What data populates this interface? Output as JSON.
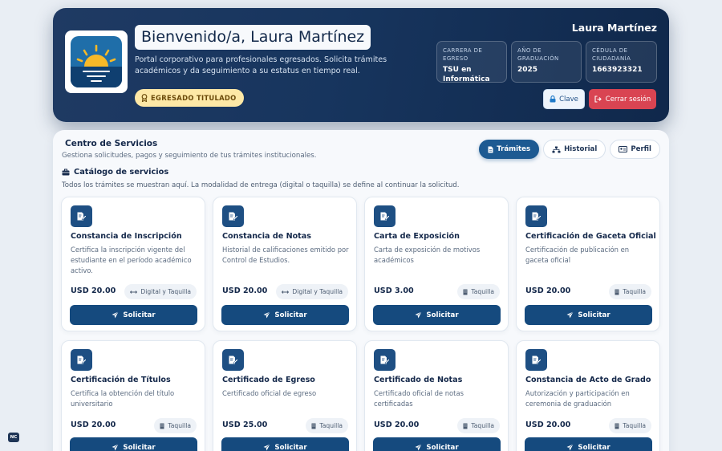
{
  "header": {
    "welcome": "Bienvenido/a, Laura Martínez",
    "description": "Portal corporativo para profesionales egresados. Solicita trámites académicos y da seguimiento a su estatus en tiempo real.",
    "badge": "EGRESADO TITULADO",
    "user_name": "Laura Martínez",
    "info": [
      {
        "label": "CARRERA DE EGRESO",
        "value": "TSU en Informática"
      },
      {
        "label": "AÑO DE GRADUACIÓN",
        "value": "2025"
      },
      {
        "label": "CÉDULA DE CIUDADANÍA",
        "value": "1663923321"
      }
    ],
    "btn_password": "Clave",
    "btn_logout": "Cerrar sesión"
  },
  "main": {
    "title": "Centro de Servicios",
    "subtitle": "Gestiona solicitudes, pagos y seguimiento de tus trámites institucionales.",
    "tabs": [
      {
        "label": "Trámites",
        "icon": "file-icon"
      },
      {
        "label": "Historial",
        "icon": "sitemap-icon"
      },
      {
        "label": "Perfil",
        "icon": "id-card-icon"
      }
    ],
    "catalog_title": "Catálogo de servicios",
    "catalog_sub": "Todos los trámites se muestran aquí. La modalidad de entrega (digital o taquilla) se define al continuar la solicitud.",
    "cards": [
      {
        "title": "Constancia de Inscripción",
        "desc": "Certifica la inscripción vigente del estudiante en el período académico activo.",
        "price": "USD 20.00",
        "mode": "Digital y Taquilla",
        "mode_icon": "swap-icon",
        "action": "Solicitar"
      },
      {
        "title": "Constancia de Notas",
        "desc": "Historial de calificaciones emitido por Control de Estudios.",
        "price": "USD 20.00",
        "mode": "Digital y Taquilla",
        "mode_icon": "swap-icon",
        "action": "Solicitar"
      },
      {
        "title": "Carta de Exposición",
        "desc": "Carta de exposición de motivos académicos",
        "price": "USD 3.00",
        "mode": "Taquilla",
        "mode_icon": "building-icon",
        "action": "Solicitar"
      },
      {
        "title": "Certificación de Gaceta Oficial",
        "desc": "Certificación de publicación en gaceta oficial",
        "price": "USD 20.00",
        "mode": "Taquilla",
        "mode_icon": "building-icon",
        "action": "Solicitar"
      },
      {
        "title": "Certificación de Títulos",
        "desc": "Certifica la obtención del título universitario",
        "price": "USD 20.00",
        "mode": "Taquilla",
        "mode_icon": "building-icon",
        "action": "Solicitar"
      },
      {
        "title": "Certificado de Egreso",
        "desc": "Certificado oficial de egreso",
        "price": "USD 25.00",
        "mode": "Taquilla",
        "mode_icon": "building-icon",
        "action": "Solicitar"
      },
      {
        "title": "Certificado de Notas",
        "desc": "Certificado oficial de notas certificadas",
        "price": "USD 20.00",
        "mode": "Taquilla",
        "mode_icon": "building-icon",
        "action": "Solicitar"
      },
      {
        "title": "Constancia de Acto de Grado",
        "desc": "Autorización y participación en ceremonia de graduación",
        "price": "USD 20.00",
        "mode": "Taquilla",
        "mode_icon": "building-icon",
        "action": "Solicitar"
      }
    ]
  },
  "corner_badge": "NC",
  "colors": {
    "primary": "#154a7e",
    "header_bg": "#17355e",
    "danger": "#d94452",
    "badge_gold": "#fde8a6"
  }
}
